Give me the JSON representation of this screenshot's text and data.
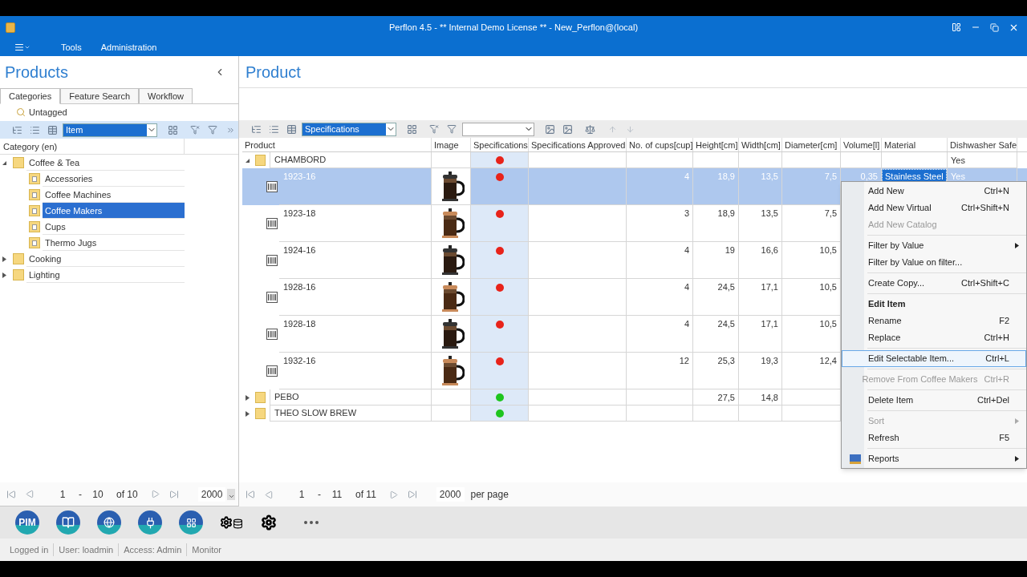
{
  "window": {
    "title": "Perflon 4.5 - ** Internal Demo License ** - New_Perflon@(local)"
  },
  "menu": {
    "items": [
      "Tools",
      "Administration"
    ]
  },
  "left": {
    "title": "Products",
    "tabs": [
      {
        "label": "Categories",
        "selected": true
      },
      {
        "label": "Feature Search",
        "selected": false
      },
      {
        "label": "Workflow",
        "selected": false
      }
    ],
    "untagged": "Untagged",
    "view": "Item",
    "column": "Category (en)",
    "tree": [
      {
        "label": "Coffee & Tea",
        "expanded": true,
        "selected": false,
        "children": [
          {
            "label": "Accessories",
            "selected": false
          },
          {
            "label": "Coffee Machines",
            "selected": false
          },
          {
            "label": "Coffee Makers",
            "selected": true
          },
          {
            "label": "Cups",
            "selected": false
          },
          {
            "label": "Thermo Jugs",
            "selected": false
          }
        ]
      },
      {
        "label": "Cooking",
        "expanded": false,
        "selected": false
      },
      {
        "label": "Lighting",
        "expanded": false,
        "selected": false
      }
    ],
    "pager": {
      "from": "1",
      "dash": "-",
      "to": "10",
      "of": "of 10",
      "size": "2000"
    }
  },
  "right": {
    "title": "Product",
    "view": "Specifications",
    "columns": [
      "Product",
      "Image",
      "Specifications",
      "Specifications Approved",
      "No. of cups[cup]",
      "Height[cm]",
      "Width[cm]",
      "Diameter[cm]",
      "Volume[l]",
      "Material",
      "Dishwasher Safe"
    ],
    "groups": [
      {
        "name": "CHAMBORD",
        "expanded": true,
        "color": "#e8231a",
        "cells": [
          null,
          null,
          null,
          null,
          null,
          null,
          "Yes"
        ],
        "rows": [
          {
            "product": "1923-16",
            "color": "#e8231a",
            "selected": true,
            "cells": [
              "4",
              "18,9",
              "13,5",
              "7,5",
              "0,35",
              "Stainless Steel",
              "Yes"
            ]
          },
          {
            "product": "1923-18",
            "color": "#e8231a",
            "selected": false,
            "cells": [
              "3",
              "18,9",
              "13,5",
              "7,5"
            ]
          },
          {
            "product": "1924-16",
            "color": "#e8231a",
            "selected": false,
            "cells": [
              "4",
              "19",
              "16,6",
              "10,5"
            ]
          },
          {
            "product": "1928-16",
            "color": "#e8231a",
            "selected": false,
            "cells": [
              "4",
              "24,5",
              "17,1",
              "10,5"
            ]
          },
          {
            "product": "1928-18",
            "color": "#e8231a",
            "selected": false,
            "cells": [
              "4",
              "24,5",
              "17,1",
              "10,5"
            ]
          },
          {
            "product": "1932-16",
            "color": "#e8231a",
            "selected": false,
            "cells": [
              "12",
              "25,3",
              "19,3",
              "12,4"
            ]
          }
        ]
      },
      {
        "name": "PEBO",
        "expanded": false,
        "color": "#1ec51e",
        "cells": [
          null,
          "27,5",
          "14,8"
        ]
      },
      {
        "name": "THEO SLOW BREW",
        "expanded": false,
        "color": "#1ec51e"
      }
    ],
    "pager": {
      "from": "1",
      "dash": "-",
      "to": "11",
      "of": "of 11",
      "size": "2000",
      "unit": "per page"
    }
  },
  "context_menu": [
    {
      "kind": "item",
      "label": "Add New",
      "shortcut": "Ctrl+N",
      "disabled": false,
      "selected": false,
      "submenu": false
    },
    {
      "kind": "item",
      "label": "Add New Virtual",
      "shortcut": "Ctrl+Shift+N",
      "disabled": false,
      "selected": false,
      "submenu": false
    },
    {
      "kind": "item",
      "label": "Add New Catalog",
      "disabled": true,
      "selected": false,
      "submenu": false
    },
    {
      "kind": "separator"
    },
    {
      "kind": "item",
      "label": "Filter by Value",
      "disabled": false,
      "selected": false,
      "submenu": true
    },
    {
      "kind": "item",
      "label": "Filter by Value on filter...",
      "disabled": false,
      "selected": false,
      "submenu": false
    },
    {
      "kind": "separator"
    },
    {
      "kind": "item",
      "label": "Create Copy...",
      "shortcut": "Ctrl+Shift+C",
      "disabled": false,
      "selected": false,
      "submenu": false
    },
    {
      "kind": "separator"
    },
    {
      "kind": "header",
      "label": "Edit Item"
    },
    {
      "kind": "item",
      "label": "Rename",
      "shortcut": "F2",
      "disabled": false,
      "selected": false,
      "submenu": false
    },
    {
      "kind": "item",
      "label": "Replace",
      "shortcut": "Ctrl+H",
      "disabled": false,
      "selected": false,
      "submenu": false
    },
    {
      "kind": "separator"
    },
    {
      "kind": "item",
      "label": "Edit Selectable Item...",
      "shortcut": "Ctrl+L",
      "disabled": false,
      "selected": true,
      "submenu": false
    },
    {
      "kind": "separator"
    },
    {
      "kind": "item",
      "label": "Remove From Coffee Makers",
      "shortcut": "Ctrl+R",
      "disabled": true,
      "selected": false,
      "submenu": false
    },
    {
      "kind": "separator"
    },
    {
      "kind": "item",
      "label": "Delete Item",
      "shortcut": "Ctrl+Del",
      "disabled": false,
      "selected": false,
      "submenu": false
    },
    {
      "kind": "separator"
    },
    {
      "kind": "item",
      "label": "Sort",
      "disabled": true,
      "selected": false,
      "submenu": true
    },
    {
      "kind": "item",
      "label": "Refresh",
      "shortcut": "F5",
      "disabled": false,
      "selected": false,
      "submenu": false
    },
    {
      "kind": "separator"
    },
    {
      "kind": "item",
      "label": "Reports",
      "disabled": false,
      "selected": false,
      "submenu": true,
      "icon": true
    }
  ],
  "apps": [
    {
      "kind": "text",
      "label": "PIM"
    },
    {
      "kind": "book"
    },
    {
      "kind": "globe"
    },
    {
      "kind": "plug"
    },
    {
      "kind": "windows"
    },
    {
      "kind": "gears-db"
    },
    {
      "kind": "gears"
    },
    {
      "kind": "more"
    }
  ],
  "status_bar": [
    "Logged in",
    "User: loadmin",
    "Access: Admin",
    "Monitor"
  ]
}
